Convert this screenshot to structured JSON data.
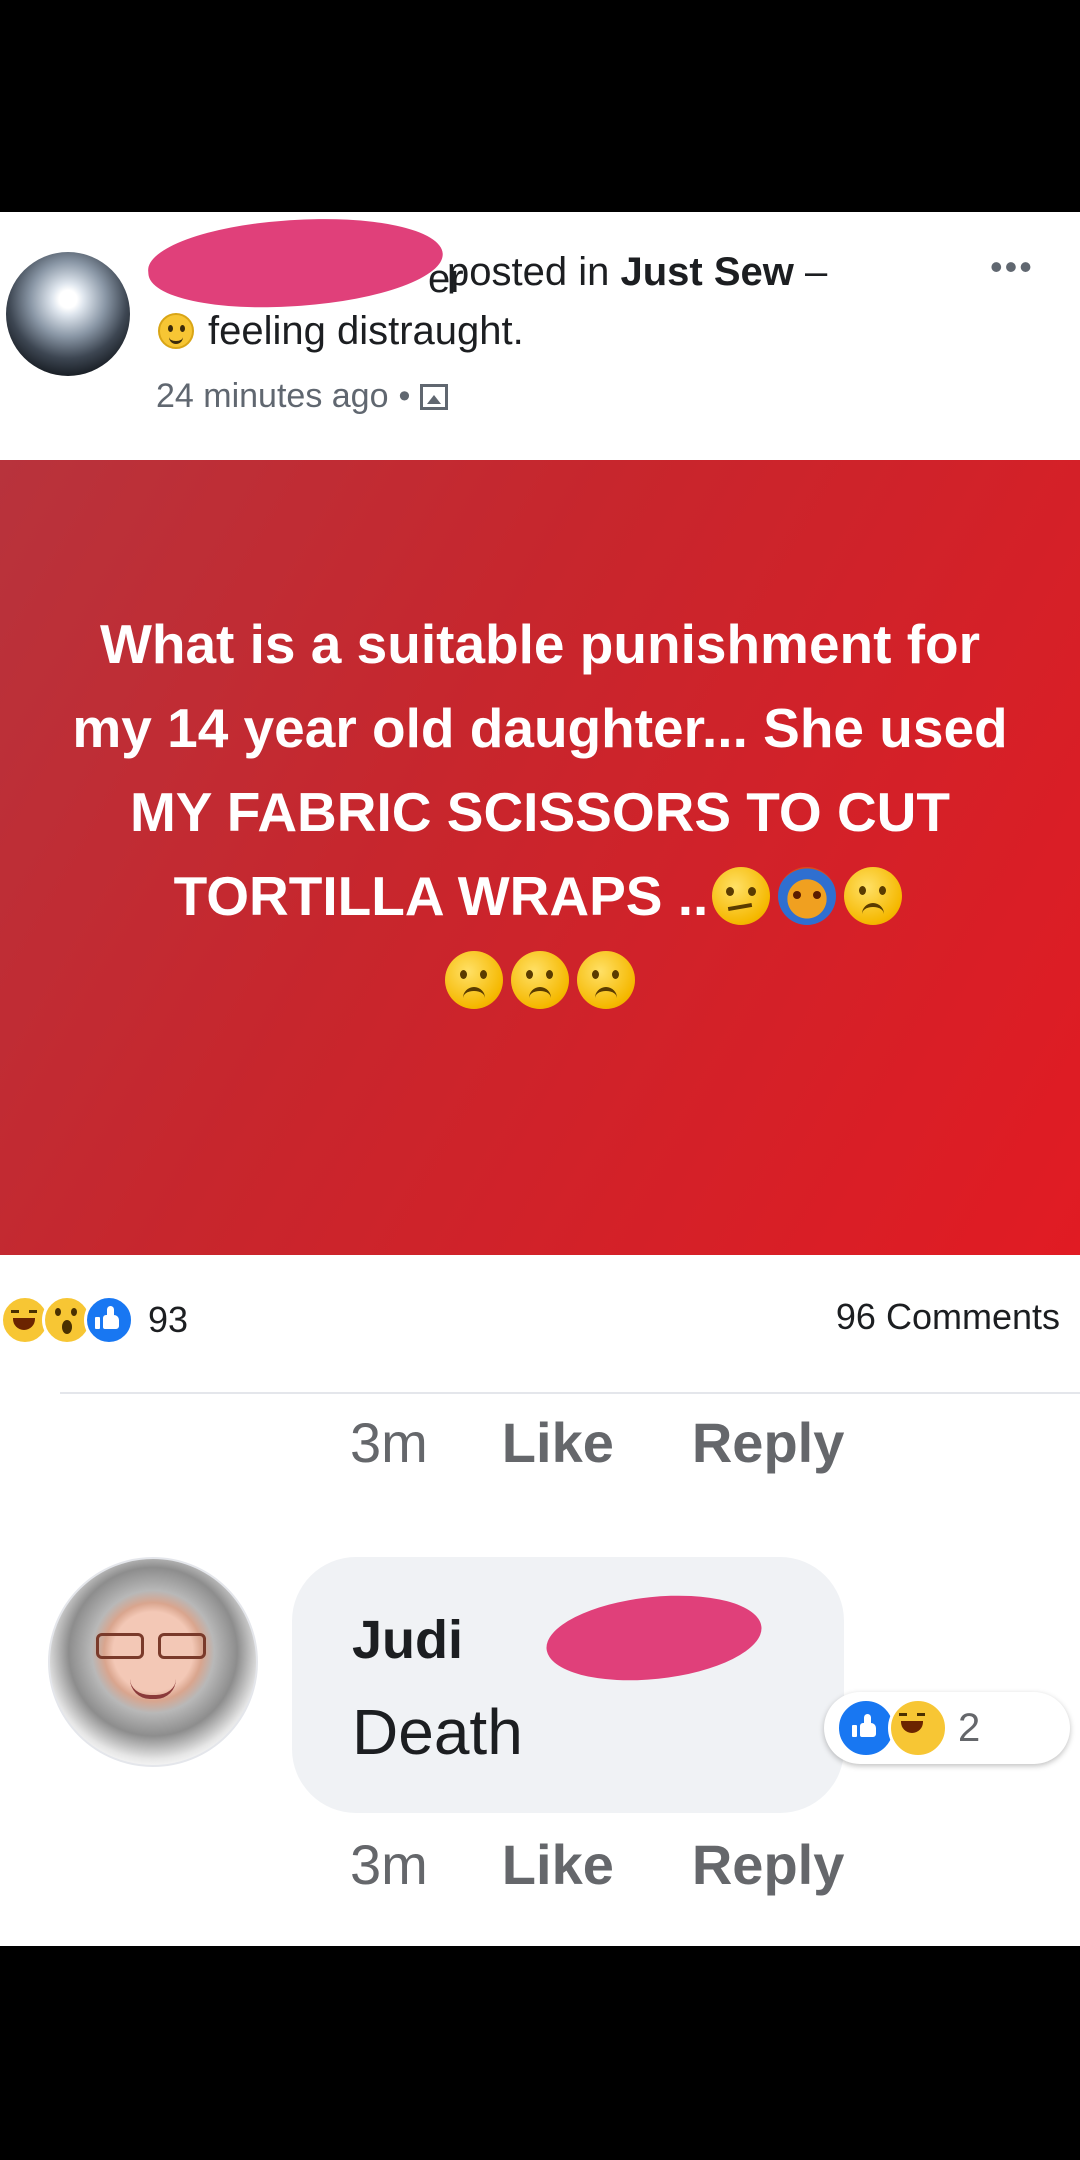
{
  "post": {
    "author_tail": "er",
    "posted_in_prefix": "posted in ",
    "group": "Just Sew",
    "dash": " –",
    "more": "•••",
    "feeling": "feeling distraught.",
    "time": "24 minutes ago",
    "dot": "•",
    "privacy_icon": "photo-icon",
    "banner_text": "What is a suitable punishment for my 14 year old daughter... She used MY FABRIC SCISSORS TO CUT TORTILLA WRAPS ..",
    "banner_color": "#e11b23"
  },
  "stats": {
    "reactions": [
      "haha",
      "wow",
      "like"
    ],
    "reaction_count": "93",
    "comments": "96 Comments"
  },
  "action_rows": [
    {
      "time": "3m",
      "like": "Like",
      "reply": "Reply"
    },
    {
      "time": "3m",
      "like": "Like",
      "reply": "Reply"
    }
  ],
  "comment": {
    "author": "Judi",
    "text": "Death",
    "reactions": [
      "like",
      "haha"
    ],
    "reaction_count": "2"
  }
}
